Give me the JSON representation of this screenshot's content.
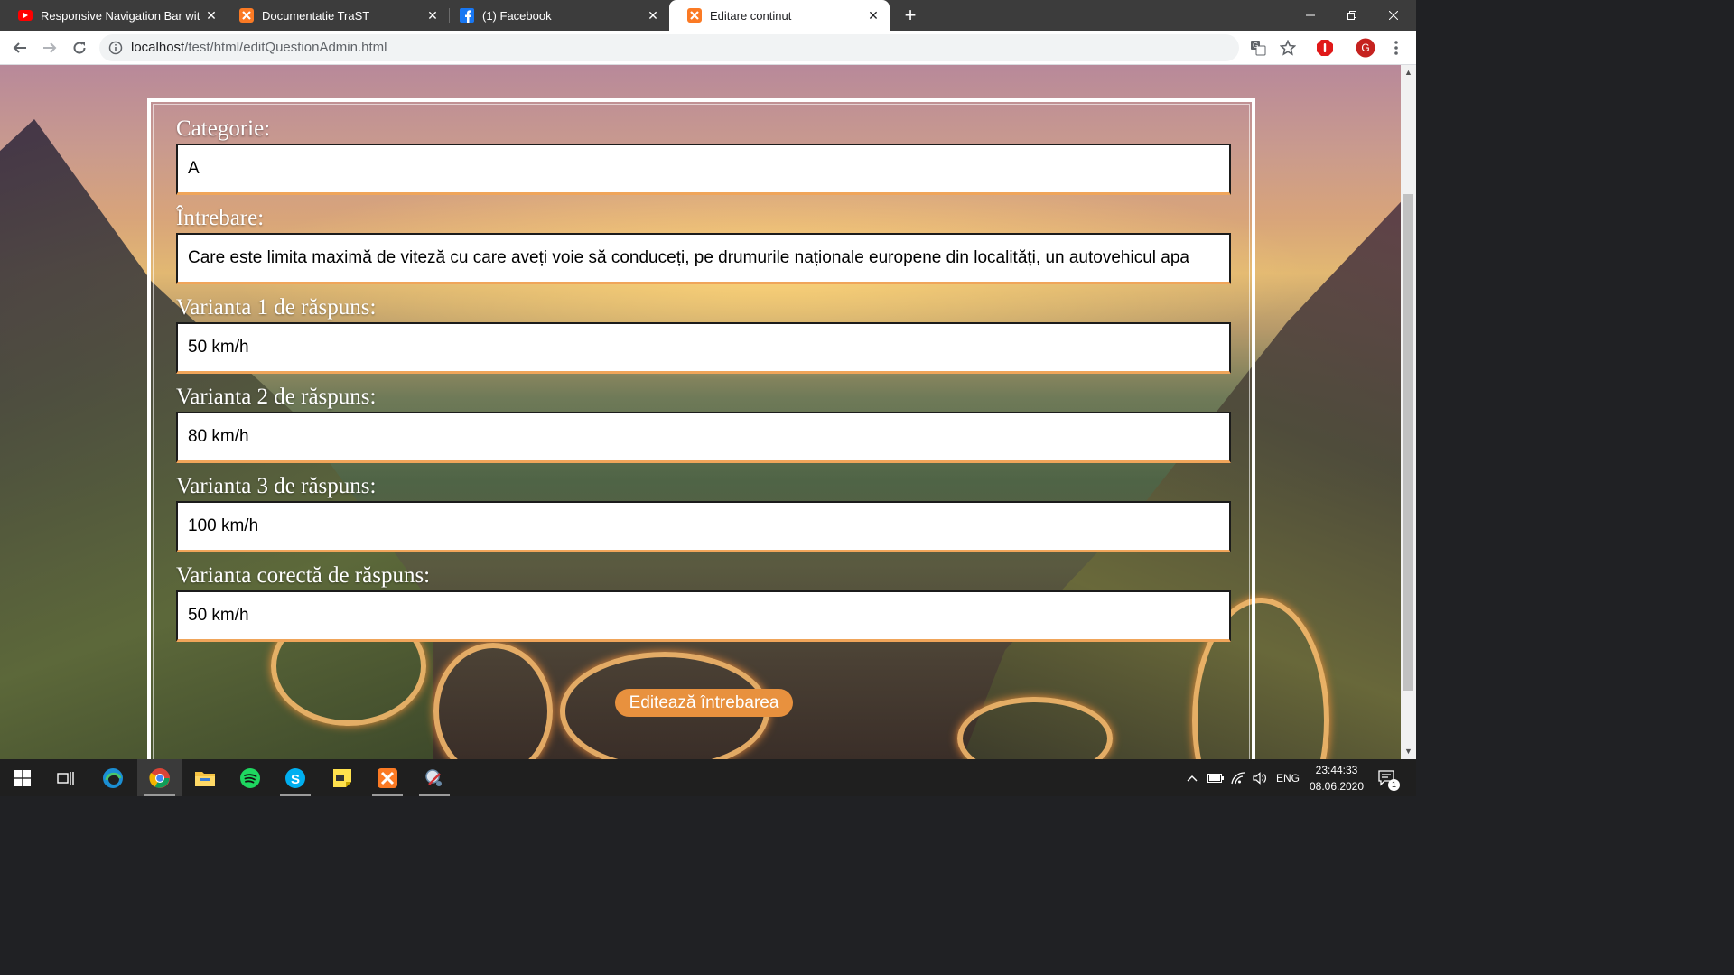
{
  "browser": {
    "tabs": [
      {
        "title": "Responsive Navigation Bar with I",
        "icon": "youtube-icon",
        "active": false
      },
      {
        "title": "Documentatie TraST",
        "icon": "xampp-icon",
        "active": false
      },
      {
        "title": "(1) Facebook",
        "icon": "facebook-icon",
        "active": false
      },
      {
        "title": "Editare continut",
        "icon": "xampp-icon",
        "active": true
      }
    ],
    "close_glyph": "✕",
    "new_tab_glyph": "+",
    "url_host": "localhost",
    "url_path": "/test/html/editQuestionAdmin.html",
    "profile_initial": "G"
  },
  "form": {
    "category_label": "Categorie:",
    "category_value": "A",
    "question_label": "Întrebare:",
    "question_value": "Care este limita maximă de viteză cu care aveți voie să conduceți, pe drumurile naționale europene din localități, un autovehicul apa",
    "answer1_label": "Varianta 1 de răspuns:",
    "answer1_value": "50 km/h",
    "answer2_label": "Varianta 2 de răspuns:",
    "answer2_value": "80 km/h",
    "answer3_label": "Varianta 3 de răspuns:",
    "answer3_value": "100 km/h",
    "correct_label": "Varianta corectă de răspuns:",
    "correct_value": "50 km/h",
    "submit_label": "Editează întrebarea"
  },
  "taskbar": {
    "language": "ENG",
    "time": "23:44:33",
    "date": "08.06.2020",
    "notification_count": "1"
  },
  "colors": {
    "accent": "#e8913e",
    "input_underline": "#f0a55a",
    "tabstrip": "#3c3c3c",
    "taskbar": "#1f1f1f"
  }
}
